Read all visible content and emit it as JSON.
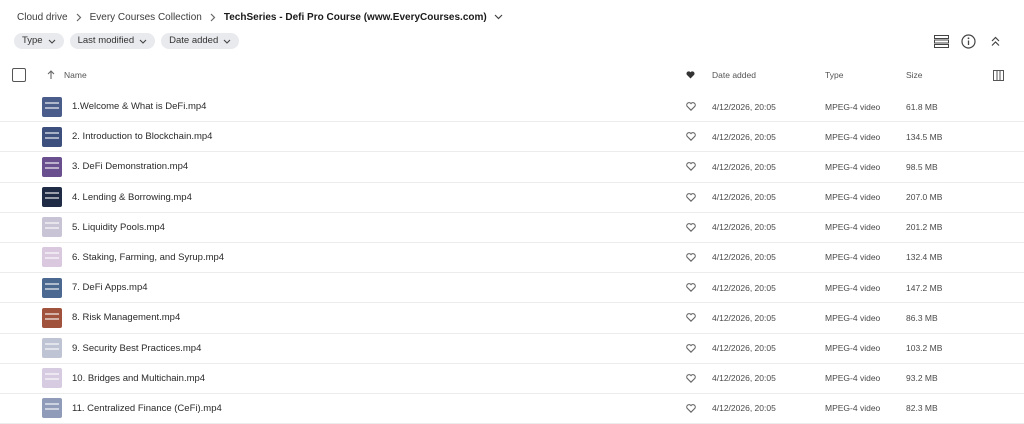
{
  "breadcrumb": {
    "items": [
      "Cloud drive",
      "Every Courses Collection"
    ],
    "current": "TechSeries - Defi Pro Course (www.EveryCourses.com)"
  },
  "filters": [
    {
      "label": "Type"
    },
    {
      "label": "Last modified"
    },
    {
      "label": "Date added"
    }
  ],
  "table": {
    "headers": {
      "name": "Name",
      "date_added": "Date added",
      "type": "Type",
      "size": "Size"
    },
    "rows": [
      {
        "name": "1.Welcome & What is DeFi.mp4",
        "date": "4/12/2026, 20:05",
        "type": "MPEG-4 video",
        "size": "61.8 MB",
        "thumb": "#4a5d8a"
      },
      {
        "name": "2. Introduction to Blockchain.mp4",
        "date": "4/12/2026, 20:05",
        "type": "MPEG-4 video",
        "size": "134.5 MB",
        "thumb": "#3d4f7c"
      },
      {
        "name": "3. DeFi Demonstration.mp4",
        "date": "4/12/2026, 20:05",
        "type": "MPEG-4 video",
        "size": "98.5 MB",
        "thumb": "#6a4f8f"
      },
      {
        "name": "4. Lending & Borrowing.mp4",
        "date": "4/12/2026, 20:05",
        "type": "MPEG-4 video",
        "size": "207.0 MB",
        "thumb": "#1f2a44"
      },
      {
        "name": "5. Liquidity Pools.mp4",
        "date": "4/12/2026, 20:05",
        "type": "MPEG-4 video",
        "size": "201.2 MB",
        "thumb": "#c9c3d6"
      },
      {
        "name": "6. Staking, Farming, and Syrup.mp4",
        "date": "4/12/2026, 20:05",
        "type": "MPEG-4 video",
        "size": "132.4 MB",
        "thumb": "#d9c8de"
      },
      {
        "name": "7. DeFi Apps.mp4",
        "date": "4/12/2026, 20:05",
        "type": "MPEG-4 video",
        "size": "147.2 MB",
        "thumb": "#4b6890"
      },
      {
        "name": "8. Risk Management.mp4",
        "date": "4/12/2026, 20:05",
        "type": "MPEG-4 video",
        "size": "86.3 MB",
        "thumb": "#a0523d"
      },
      {
        "name": "9. Security Best Practices.mp4",
        "date": "4/12/2026, 20:05",
        "type": "MPEG-4 video",
        "size": "103.2 MB",
        "thumb": "#bfc4d4"
      },
      {
        "name": "10. Bridges and Multichain.mp4",
        "date": "4/12/2026, 20:05",
        "type": "MPEG-4 video",
        "size": "93.2 MB",
        "thumb": "#d6cbe0"
      },
      {
        "name": "11. Centralized Finance (CeFi).mp4",
        "date": "4/12/2026, 20:05",
        "type": "MPEG-4 video",
        "size": "82.3 MB",
        "thumb": "#8f9bb8"
      }
    ]
  },
  "icons": {
    "breadcrumb_sep": "chevron-right-icon",
    "breadcrumb_menu": "chevron-down-icon",
    "filter_chip": "chevron-down-icon",
    "list_view": "list-view-icon",
    "info": "info-icon",
    "collapse": "chevrons-up-icon",
    "sort": "arrow-up-icon",
    "favourite_header": "heart-filled-icon",
    "favourite_row": "heart-outline-icon",
    "columns": "columns-icon"
  }
}
